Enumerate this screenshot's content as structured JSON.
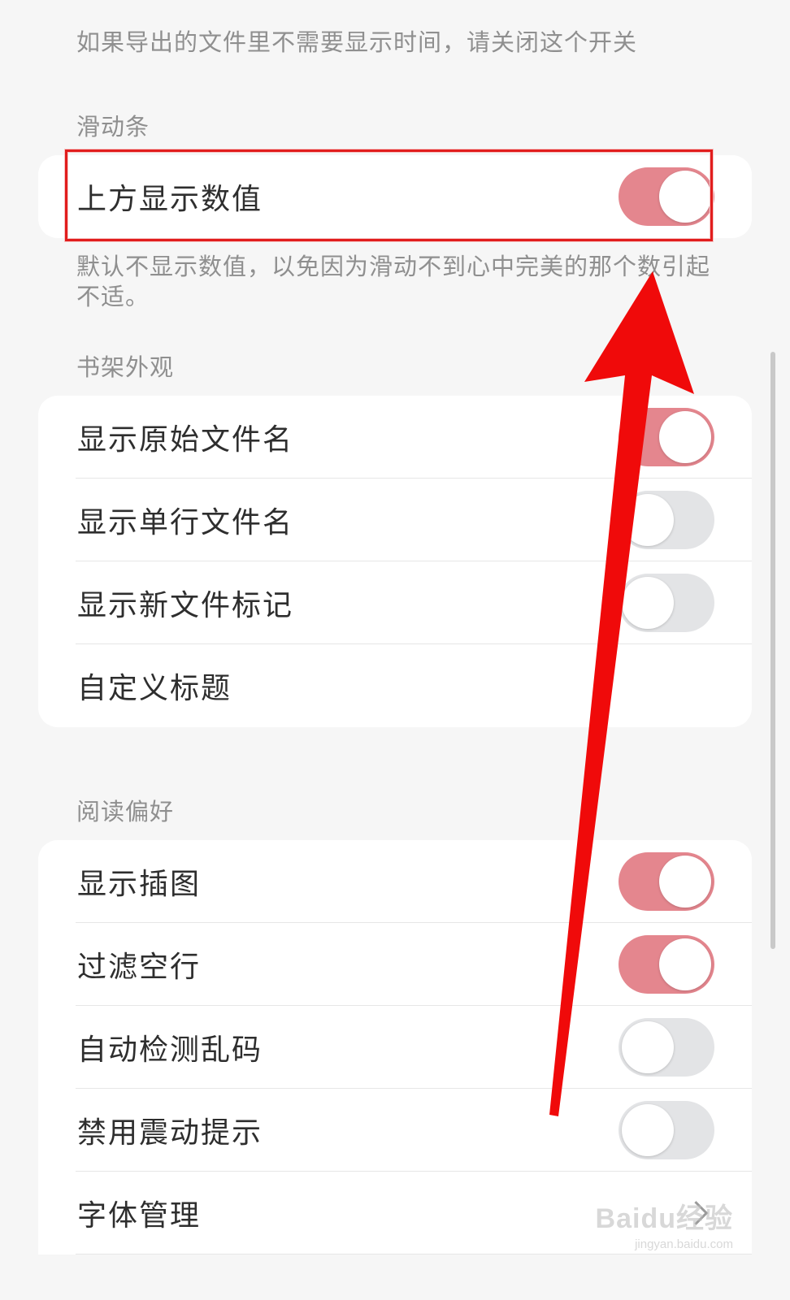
{
  "top_note": "如果导出的文件里不需要显示时间，请关闭这个开关",
  "slider_section": {
    "title": "滑动条",
    "items": [
      {
        "label": "上方显示数值",
        "toggle": true
      }
    ],
    "note": "默认不显示数值，以免因为滑动不到心中完美的那个数引起不适。"
  },
  "bookshelf_section": {
    "title": "书架外观",
    "items": [
      {
        "label": "显示原始文件名",
        "toggle": true
      },
      {
        "label": "显示单行文件名",
        "toggle": false
      },
      {
        "label": "显示新文件标记",
        "toggle": false
      },
      {
        "label": "自定义标题"
      }
    ]
  },
  "reading_section": {
    "title": "阅读偏好",
    "items": [
      {
        "label": "显示插图",
        "toggle": true
      },
      {
        "label": "过滤空行",
        "toggle": true
      },
      {
        "label": "自动检测乱码",
        "toggle": false
      },
      {
        "label": "禁用震动提示",
        "toggle": false
      },
      {
        "label": "字体管理",
        "icon": "chevron-right-icon"
      }
    ]
  },
  "watermark": {
    "brand": "Baidu经验",
    "url": "jingyan.baidu.com"
  },
  "colors": {
    "toggle_on": "#e4868e",
    "toggle_off": "#e3e4e6",
    "highlight": "#e11d1d",
    "arrow": "#f00a0a"
  }
}
